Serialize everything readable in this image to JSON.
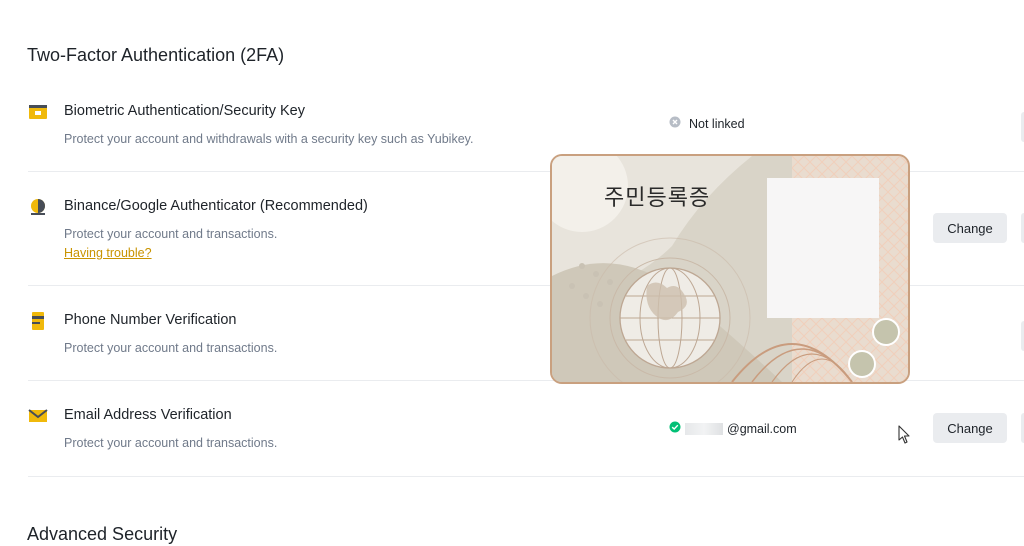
{
  "section_2fa": {
    "title": "Two-Factor Authentication (2FA)"
  },
  "rows": [
    {
      "icon": "security-key-icon",
      "title": "Biometric Authentication/Security Key",
      "desc": "Protect your account and withdrawals with a security key such as Yubikey.",
      "status": "Not linked"
    },
    {
      "icon": "authenticator-icon",
      "title": "Binance/Google Authenticator (Recommended)",
      "desc": "Protect your account and transactions.",
      "link": "Having trouble?",
      "button": "Change"
    },
    {
      "icon": "phone-icon",
      "title": "Phone Number Verification",
      "desc": "Protect your account and transactions."
    },
    {
      "icon": "email-icon",
      "title": "Email Address Verification",
      "desc": "Protect your account and transactions.",
      "status": "@gmail.com",
      "button": "Change"
    }
  ],
  "section_advanced": {
    "title": "Advanced Security"
  },
  "id_card": {
    "title": "주민등록증"
  },
  "colors": {
    "accent": "#f0b90b",
    "link": "#c99400",
    "success": "#02c076",
    "muted": "#707a8a"
  }
}
